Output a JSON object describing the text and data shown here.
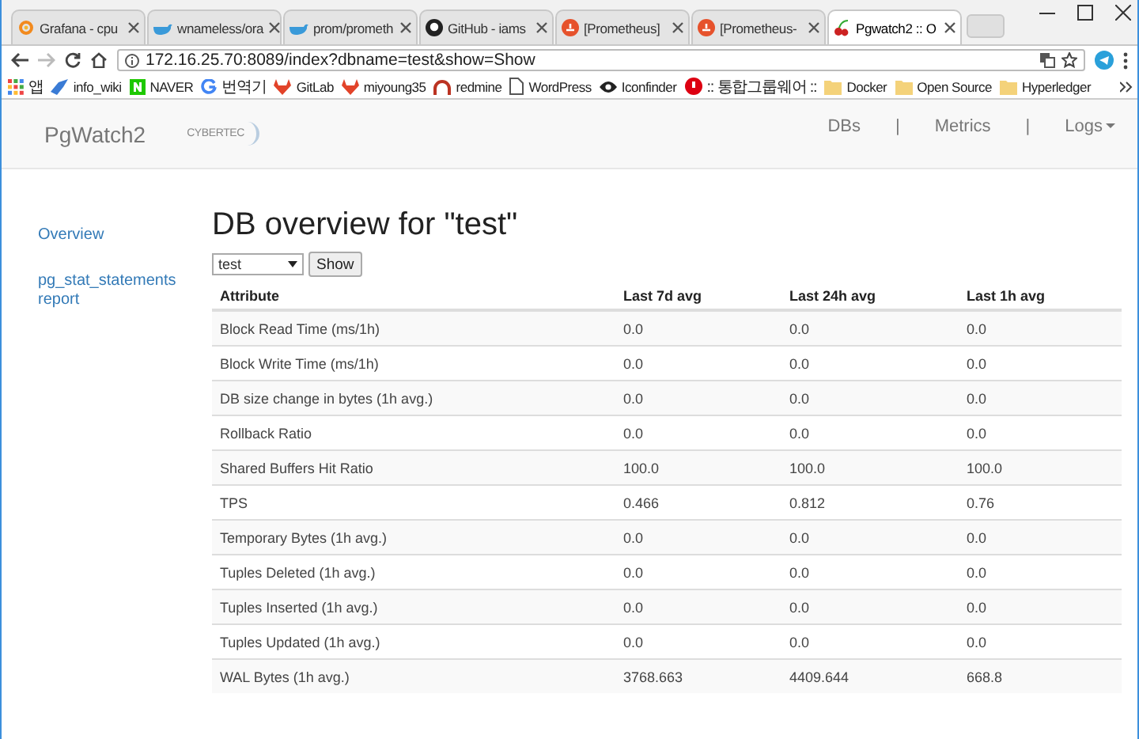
{
  "browser": {
    "tabs": [
      {
        "title": "Grafana - cpu",
        "selected": false
      },
      {
        "title": "wnameless/ora",
        "selected": false
      },
      {
        "title": "prom/prometh",
        "selected": false
      },
      {
        "title": "GitHub - iams",
        "selected": false
      },
      {
        "title": "[Prometheus]",
        "selected": false
      },
      {
        "title": "[Prometheus-",
        "selected": false
      },
      {
        "title": "Pgwatch2 :: O",
        "selected": true
      }
    ],
    "address": "172.16.25.70:8089/index?dbname=test&show=Show",
    "bookmarks": [
      "앱",
      "info_wiki",
      "NAVER",
      "번역기",
      "GitLab",
      "miyoung35",
      "redmine",
      "WordPress",
      "Iconfinder",
      ":: 통합그룹웨어 ::",
      "Docker",
      "Open Source",
      "Hyperledger"
    ]
  },
  "navbar": {
    "brand": "PgWatch2",
    "logo": "CYBERTEC",
    "links": [
      {
        "label": "DBs",
        "kind": "link"
      },
      {
        "label": "|",
        "kind": "separator"
      },
      {
        "label": "Metrics",
        "kind": "link"
      },
      {
        "label": "|",
        "kind": "separator"
      },
      {
        "label": "Logs",
        "kind": "dropdown"
      }
    ]
  },
  "sidebar": {
    "items": [
      "Overview",
      "pg_stat_statements report"
    ]
  },
  "main": {
    "title": "DB overview for \"test\"",
    "db_select": {
      "value": "test"
    },
    "show_button": "Show",
    "table": {
      "columns": [
        "Attribute",
        "Last 7d avg",
        "Last 24h avg",
        "Last 1h avg"
      ],
      "rows": [
        [
          "Block Read Time (ms/1h)",
          "0.0",
          "0.0",
          "0.0"
        ],
        [
          "Block Write Time (ms/1h)",
          "0.0",
          "0.0",
          "0.0"
        ],
        [
          "DB size change in bytes (1h avg.)",
          "0.0",
          "0.0",
          "0.0"
        ],
        [
          "Rollback Ratio",
          "0.0",
          "0.0",
          "0.0"
        ],
        [
          "Shared Buffers Hit Ratio",
          "100.0",
          "100.0",
          "100.0"
        ],
        [
          "TPS",
          "0.466",
          "0.812",
          "0.76"
        ],
        [
          "Temporary Bytes (1h avg.)",
          "0.0",
          "0.0",
          "0.0"
        ],
        [
          "Tuples Deleted (1h avg.)",
          "0.0",
          "0.0",
          "0.0"
        ],
        [
          "Tuples Inserted (1h avg.)",
          "0.0",
          "0.0",
          "0.0"
        ],
        [
          "Tuples Updated (1h avg.)",
          "0.0",
          "0.0",
          "0.0"
        ],
        [
          "WAL Bytes (1h avg.)",
          "3768.663",
          "4409.644",
          "668.8"
        ]
      ]
    }
  }
}
